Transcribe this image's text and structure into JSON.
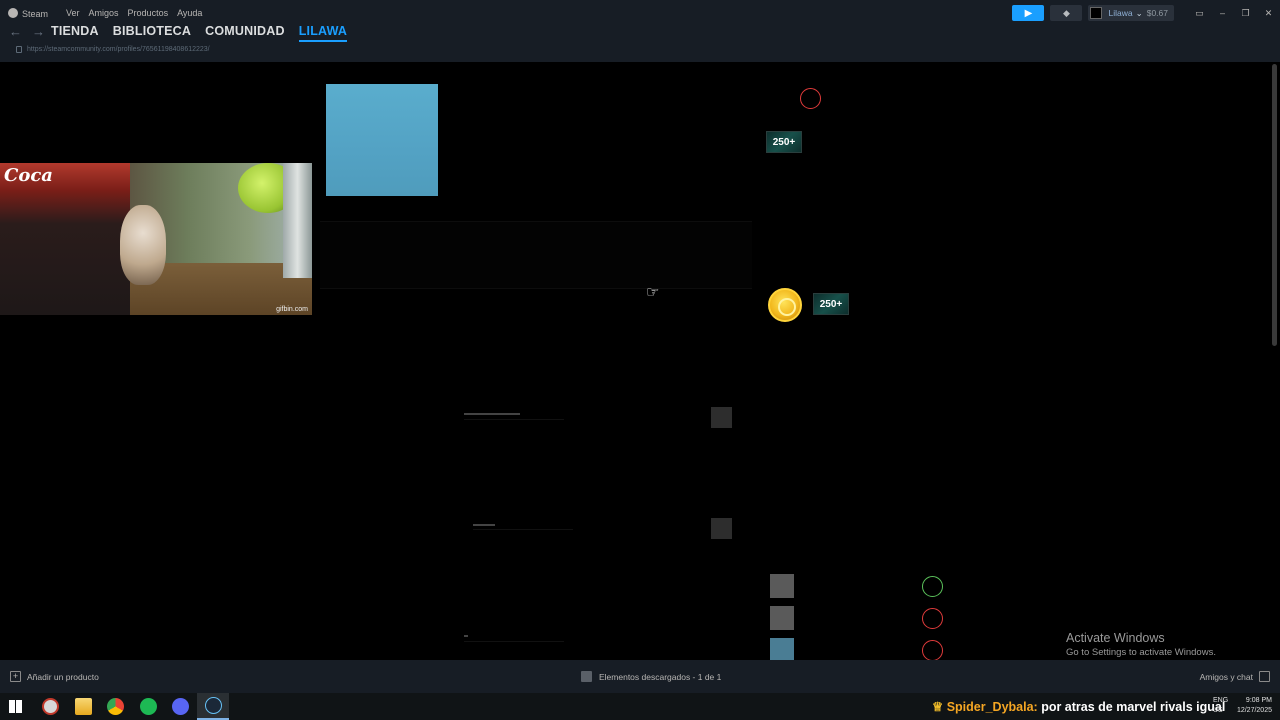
{
  "menu": {
    "app": "Steam",
    "items": [
      "Ver",
      "Amigos",
      "Productos",
      "Ayuda"
    ]
  },
  "nav": {
    "back_icon": "arrow-left-icon",
    "forward_icon": "arrow-right-icon"
  },
  "tabs": [
    "TIENDA",
    "BIBLIOTECA",
    "COMUNIDAD",
    "LILAWA"
  ],
  "active_tab": "LILAWA",
  "url": "https://steamcommunity.com/profiles/76561198408612223/",
  "account": {
    "name": "Lilawa",
    "wallet": "$0.67"
  },
  "content": {
    "gif_watermark": "gifbin.com",
    "bottle_text": "Coca",
    "badge_label": "250+",
    "accent_blue": "#1a9fff"
  },
  "statusbar": {
    "add_product": "Añadir un producto",
    "downloads": "Elementos descargados - 1 de 1",
    "friends_chat": "Amigos y chat"
  },
  "watermark": {
    "title": "Activate Windows",
    "subtitle": "Go to Settings to activate Windows."
  },
  "taskbar": {
    "ticker_user": "Spider_Dybala:",
    "ticker_message": "por atras de marvel rivals igual",
    "lang_line1": "ENG",
    "lang_line2": "US",
    "time": "9:08 PM",
    "date": "12/27/2025"
  }
}
